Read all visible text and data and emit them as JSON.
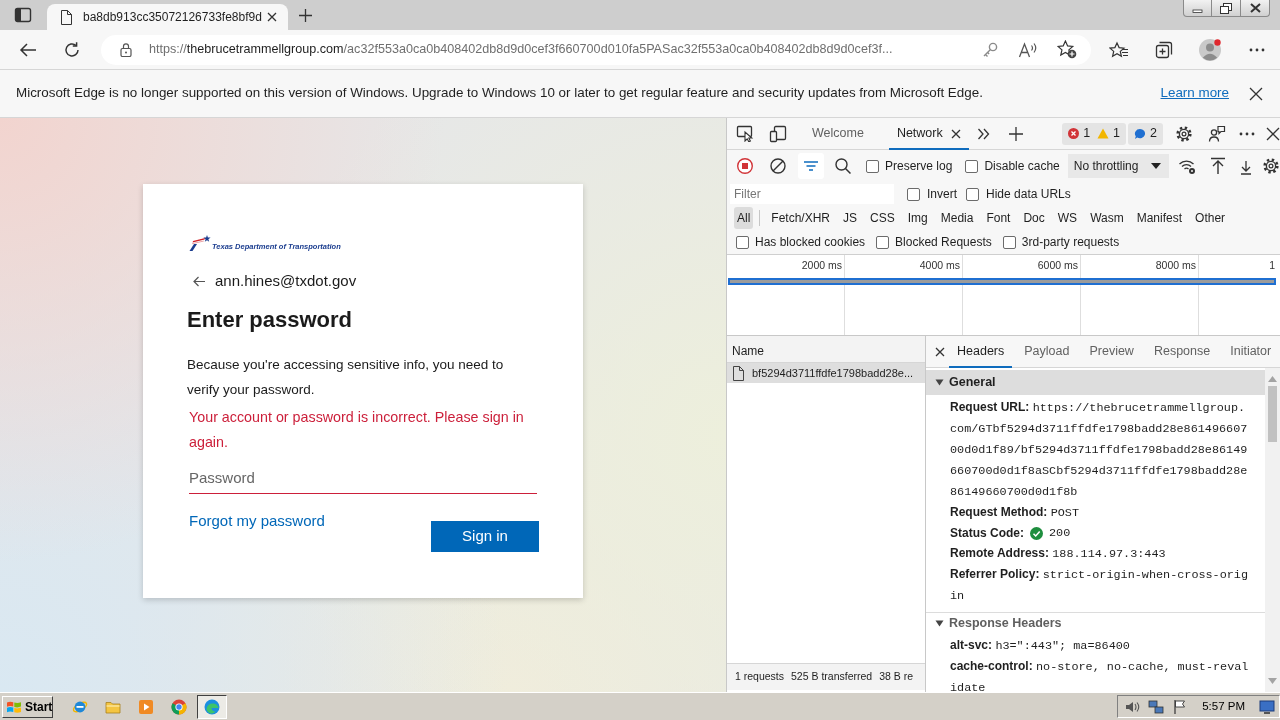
{
  "browser": {
    "tabs": [
      {
        "title": "ba8db913cc35072126733fe8bf9d",
        "selected": true
      }
    ],
    "address": {
      "scheme": "https://",
      "host": "thebrucetrammellgroup.com",
      "path": "/ac32f553a0ca0b408402db8d9d0cef3f660700d010fa5PASac32f553a0ca0b408402db8d9d0cef3f..."
    },
    "profile": {
      "notification": true
    },
    "info_bar": {
      "message": "Microsoft Edge is no longer supported on this version of Windows. Upgrade to Windows 10 or later to get regular feature and security updates from Microsoft Edge.",
      "link": "Learn more"
    }
  },
  "sign_in": {
    "logo_text": "Texas Department of Transportation",
    "account": "ann.hines@txdot.gov",
    "heading": "Enter password",
    "description": "Because you're accessing sensitive info, you need to verify your password.",
    "error": "Your account or password is incorrect. Please sign in again.",
    "password": {
      "placeholder": "Password",
      "invalid": true
    },
    "forgot_link": "Forgot my password",
    "submit": "Sign in"
  },
  "devtools": {
    "tabs": [
      {
        "label": "Welcome",
        "selected": false
      },
      {
        "label": "Network",
        "selected": true
      }
    ],
    "issues": {
      "errors": "1",
      "warnings": "1",
      "messages": "2"
    },
    "recording": true,
    "filter_bar_shown": true,
    "toolbar_options": [
      {
        "label": "Preserve log",
        "checked": false
      },
      {
        "label": "Disable cache",
        "checked": false
      }
    ],
    "throttling": "No throttling",
    "filter": {
      "placeholder": "Filter"
    },
    "filter_options": [
      {
        "label": "Invert",
        "checked": false
      },
      {
        "label": "Hide data URLs",
        "checked": false
      }
    ],
    "resource_types": [
      {
        "label": "All",
        "selected": true
      },
      {
        "label": "Fetch/XHR",
        "selected": false
      },
      {
        "label": "JS",
        "selected": false
      },
      {
        "label": "CSS",
        "selected": false
      },
      {
        "label": "Img",
        "selected": false
      },
      {
        "label": "Media",
        "selected": false
      },
      {
        "label": "Font",
        "selected": false
      },
      {
        "label": "Doc",
        "selected": false
      },
      {
        "label": "WS",
        "selected": false
      },
      {
        "label": "Wasm",
        "selected": false
      },
      {
        "label": "Manifest",
        "selected": false
      },
      {
        "label": "Other",
        "selected": false
      }
    ],
    "request_options": [
      {
        "label": "Has blocked cookies",
        "checked": false
      },
      {
        "label": "Blocked Requests",
        "checked": false
      },
      {
        "label": "3rd-party requests",
        "checked": false
      }
    ],
    "overview_ticks": [
      "2000 ms",
      "4000 ms",
      "6000 ms",
      "8000 ms",
      "1"
    ],
    "requests": {
      "column": "Name",
      "rows": [
        {
          "name": "bf5294d3711ffdfe1798badd28e...",
          "selected": true
        }
      ],
      "summary": [
        "1 requests",
        "525 B transferred",
        "38 B re"
      ]
    },
    "detail_tabs": [
      {
        "label": "Headers",
        "selected": true
      },
      {
        "label": "Payload",
        "selected": false
      },
      {
        "label": "Preview",
        "selected": false
      },
      {
        "label": "Response",
        "selected": false
      },
      {
        "label": "Initiator",
        "selected": false
      }
    ],
    "sections": [
      {
        "title": "General",
        "expanded": true,
        "highlighted": true,
        "fields": [
          {
            "kind": "text",
            "label": "Request URL:",
            "value": "https://thebrucetrammellgroup.com/GTbf5294d3711ffdfe1798badd28e86149660700d0d1f89/bf5294d3711ffdfe1798badd28e86149660700d0d1f8aSCbf5294d3711ffdfe1798badd28e86149660700d0d1f8b"
          },
          {
            "kind": "text",
            "label": "Request Method:",
            "value": "POST"
          },
          {
            "kind": "status",
            "label": "Status Code:",
            "value": "200"
          },
          {
            "kind": "text",
            "label": "Remote Address:",
            "value": "188.114.97.3:443"
          },
          {
            "kind": "text",
            "label": "Referrer Policy:",
            "value": "strict-origin-when-cross-origin"
          }
        ]
      },
      {
        "title": "Response Headers",
        "expanded": true,
        "highlighted": false,
        "fields": [
          {
            "kind": "text",
            "label": "alt-svc:",
            "value": "h3=\":443\"; ma=86400"
          },
          {
            "kind": "text",
            "label": "cache-control:",
            "value": "no-store, no-cache, must-revalidate"
          }
        ]
      }
    ]
  },
  "taskbar": {
    "start": "Start",
    "apps": [
      {
        "kind": "ie",
        "active": false
      },
      {
        "kind": "explorer",
        "active": false
      },
      {
        "kind": "media",
        "active": false
      },
      {
        "kind": "chrome",
        "active": false
      },
      {
        "kind": "edge",
        "active": true
      }
    ],
    "clock": "5:57 PM"
  }
}
